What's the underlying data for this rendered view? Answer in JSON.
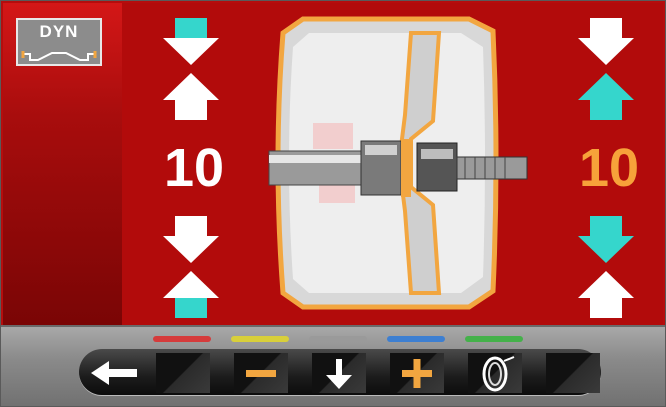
{
  "mode": {
    "label": "DYN"
  },
  "planes": {
    "left": {
      "value": "10",
      "color": "#ffffff"
    },
    "right": {
      "value": "10",
      "color": "#f7a23a"
    }
  },
  "colors": {
    "background": "#b20b0b",
    "active_arrow": "#35d6cc",
    "rim_outline": "#f2a640"
  },
  "toolbar": {
    "indicator_colors": [
      "#d53b3b",
      "#d8cf3a",
      "#9a9a9a",
      "#3d7fd1",
      "#44b14a"
    ],
    "buttons": [
      "back-arrow-icon",
      "blank",
      "minus-icon",
      "down-arrow-icon",
      "plus-icon",
      "wheel-icon",
      "blank"
    ]
  }
}
